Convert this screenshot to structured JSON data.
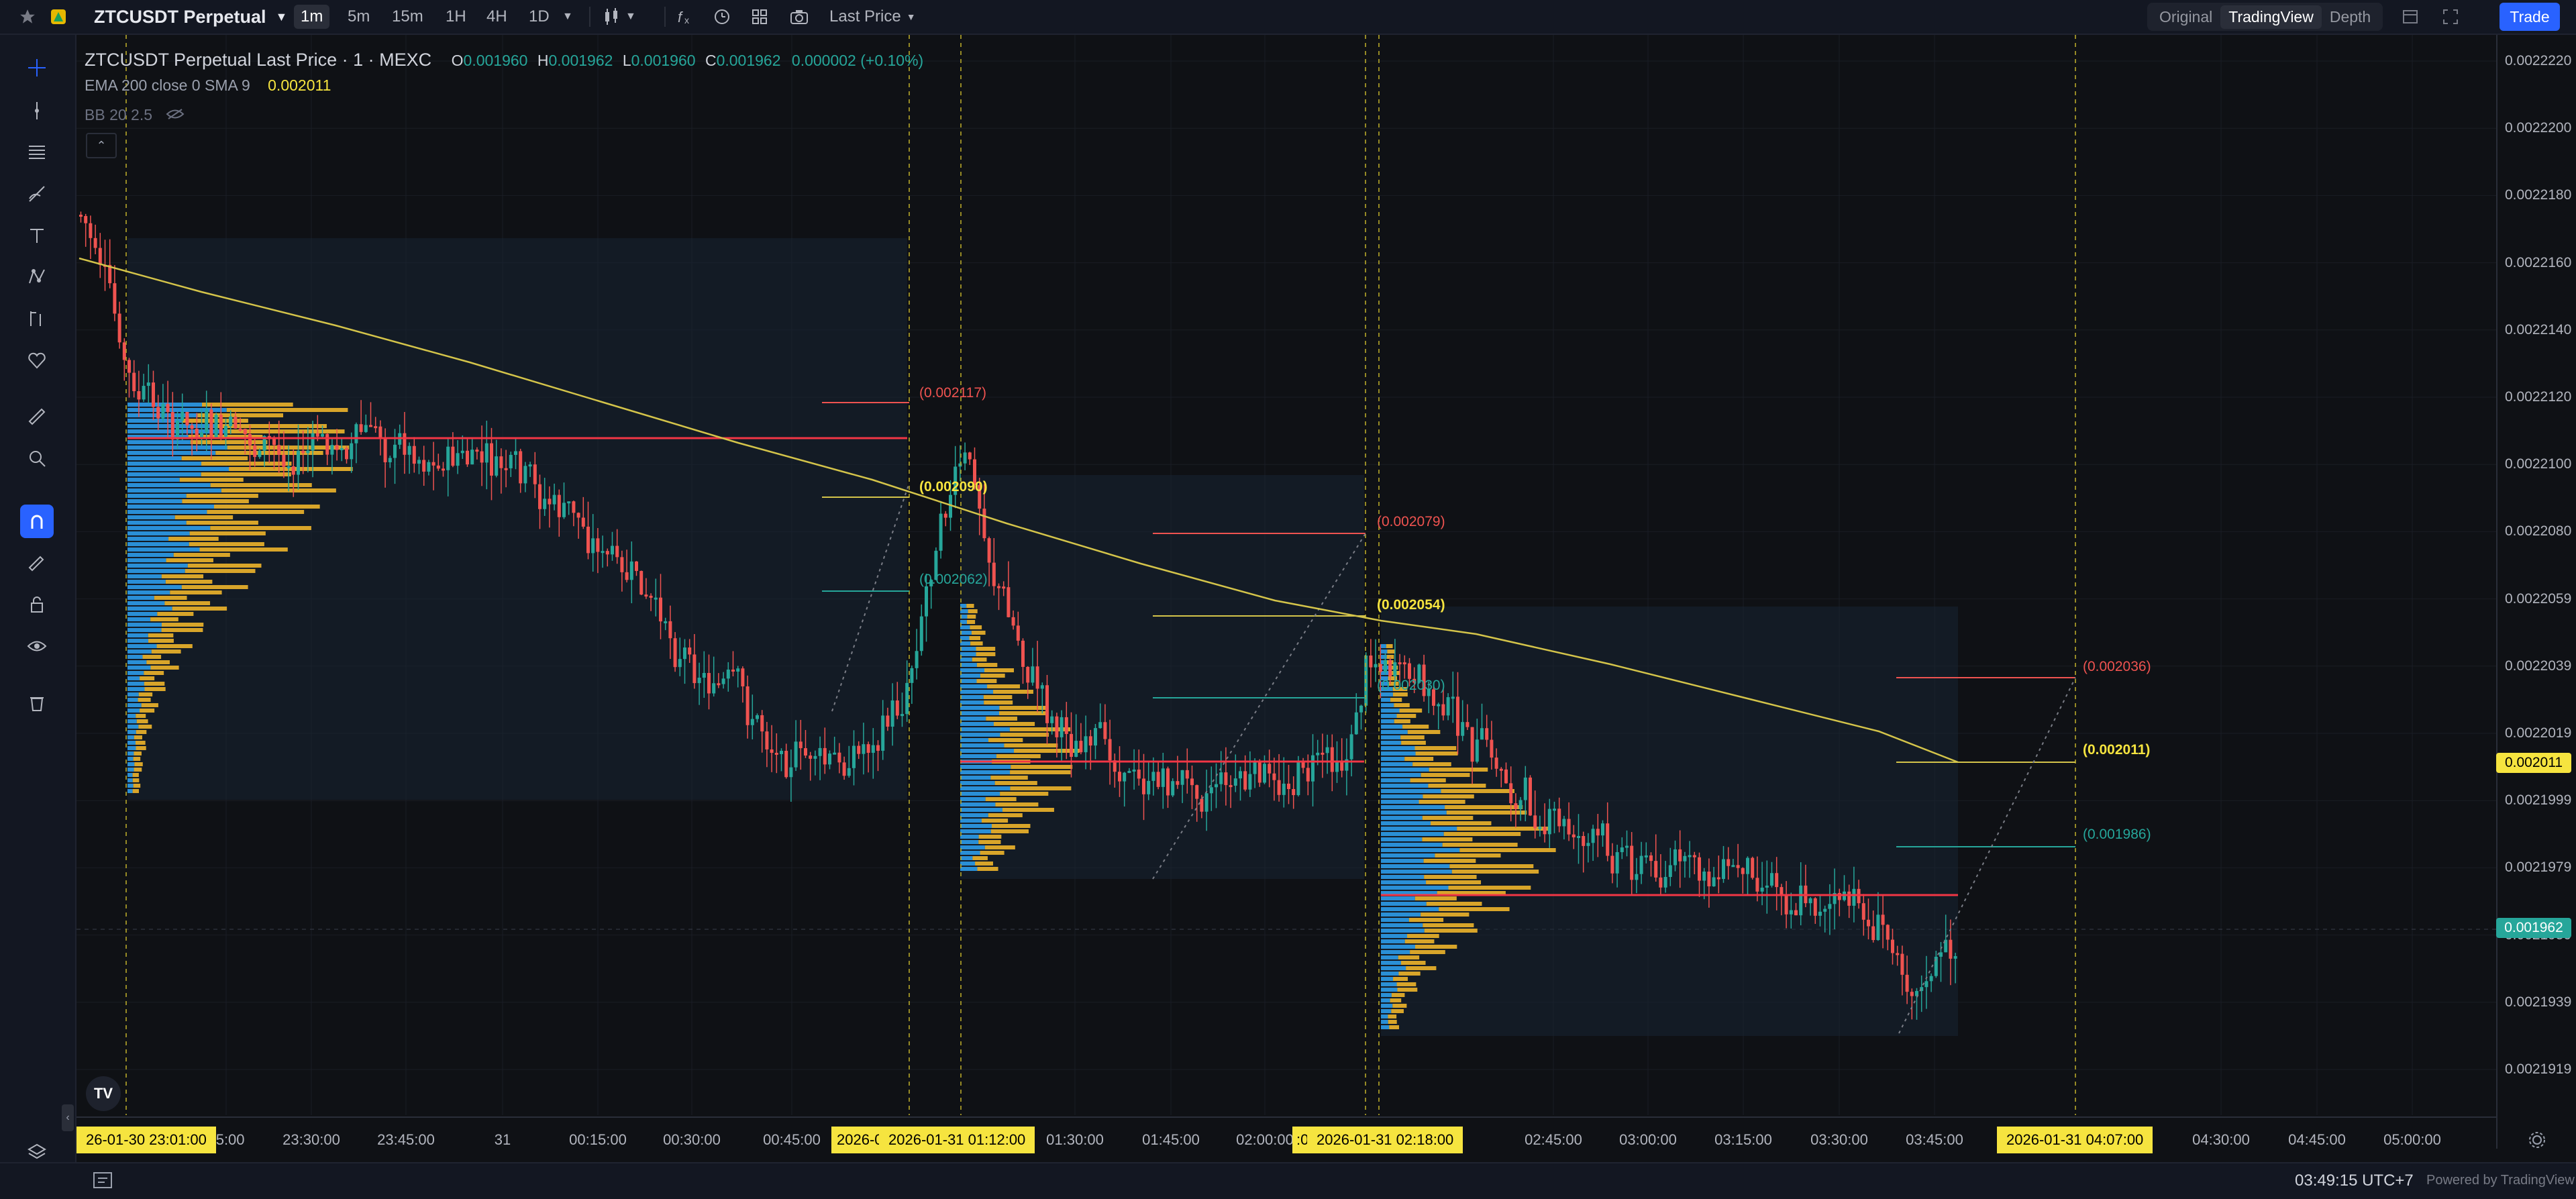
{
  "topbar": {
    "symbol": "ZTCUSDT Perpetual",
    "timeframes": [
      "1m",
      "5m",
      "15m",
      "1H",
      "4H",
      "1D"
    ],
    "active_timeframe": "1m",
    "price_source": "Last Price",
    "views": [
      "Original",
      "TradingView",
      "Depth"
    ],
    "active_view": "TradingView",
    "trade_label": "Trade"
  },
  "legend": {
    "title": "ZTCUSDT Perpetual Last Price · 1 · MEXC",
    "o_label": "O",
    "o_val": "0.001960",
    "h_label": "H",
    "h_val": "0.001962",
    "l_label": "L",
    "l_val": "0.001960",
    "c_label": "C",
    "c_val": "0.001962",
    "change": "0.000002 (+0.10%)",
    "ema_label": "EMA 200 close 0 SMA 9",
    "ema_val": "0.002011",
    "bb_label": "BB 20 2.5"
  },
  "price_axis": {
    "labels": [
      "0.0022220",
      "0.0022200",
      "0.0022180",
      "0.0022160",
      "0.0022140",
      "0.0022120",
      "0.0022100",
      "0.0022080",
      "0.0022059",
      "0.0022039",
      "0.0022019",
      "0.0021999",
      "0.0021979",
      "0.0021959",
      "0.0021939",
      "0.0021919"
    ],
    "ema_tag": "0.002011",
    "last_tag": "0.001962"
  },
  "time_axis": {
    "labels": [
      "15:00",
      "23:30:00",
      "23:45:00",
      "31",
      "00:15:00",
      "00:30:00",
      "00:45:00",
      "01:30:00",
      "01:45:00",
      "02:00:00",
      "02:45:00",
      "03:00:00",
      "03:15:00",
      "03:30:00",
      "03:45:00",
      "04:30:00",
      "04:45:00",
      "05:00:00"
    ],
    "cursor_tags": [
      "26-01-30  23:01:00",
      "2026-01-31  01:12:00",
      "2026-01-31  02:18:00",
      "2026-01-31  04:07:00"
    ],
    "partial_tags": [
      "2026-0",
      ":0"
    ]
  },
  "annotations": {
    "a1_top": "(0.002117)",
    "a1_mid": "(0.002090)",
    "a1_bot": "(0.002062)",
    "a2_top": "(0.002079)",
    "a2_mid": "(0.002054)",
    "a2_bot": "(0.002030)",
    "a3_top": "(0.002036)",
    "a3_mid": "(0.002011)",
    "a3_bot": "(0.001986)"
  },
  "bottombar": {
    "clock": "03:49:15 UTC+7",
    "brand": "Powered by TradingView"
  },
  "colors": {
    "up": "#26a69a",
    "down": "#ef5350",
    "ema": "#d4c44a",
    "poc": "#f23645",
    "vp_blue": "#2a8fd6",
    "vp_gold": "#d8a52a",
    "accent": "#2962ff",
    "cursor": "#f6e43f"
  },
  "icons": {
    "left_toolbar": [
      "crosshair-icon",
      "trendline-icon",
      "fib-icon",
      "brush-icon",
      "text-icon",
      "pattern-icon",
      "forecast-icon",
      "heart-icon",
      "ruler-icon",
      "zoom-icon",
      "magnet-icon",
      "draw-lock-icon",
      "lock-icon",
      "eye-icon",
      "trash-icon",
      "layers-icon"
    ]
  }
}
